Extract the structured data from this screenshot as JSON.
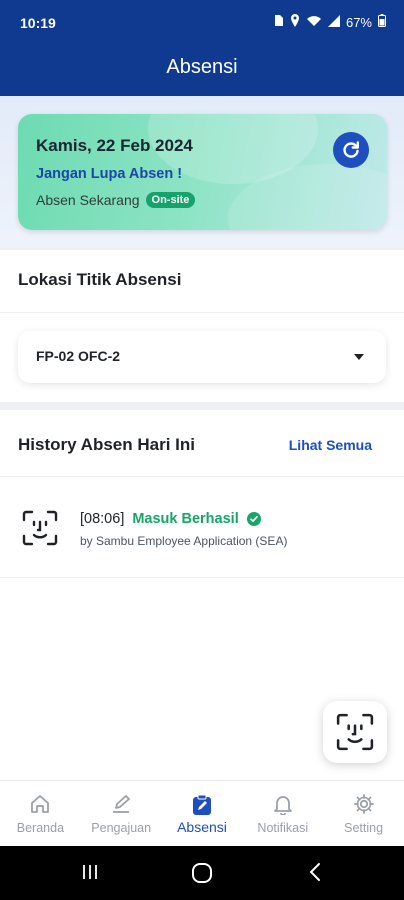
{
  "status_bar": {
    "time": "10:19",
    "battery": "67%"
  },
  "app_bar": {
    "title": "Absensi"
  },
  "date_card": {
    "date": "Kamis, 22 Feb 2024",
    "reminder": "Jangan Lupa Absen !",
    "absen_label": "Absen Sekarang",
    "badge": "On-site"
  },
  "lokasi": {
    "title": "Lokasi Titik Absensi",
    "selected": "FP-02 OFC-2"
  },
  "history": {
    "title": "History Absen Hari Ini",
    "see_all": "Lihat Semua",
    "items": [
      {
        "time": "[08:06]",
        "status": "Masuk Berhasil",
        "source": "by Sambu Employee Application (SEA)"
      }
    ]
  },
  "bottom_nav": {
    "items": [
      {
        "label": "Beranda",
        "icon": "home-icon"
      },
      {
        "label": "Pengajuan",
        "icon": "edit-icon"
      },
      {
        "label": "Absensi",
        "icon": "clipboard-icon",
        "active": true
      },
      {
        "label": "Notifikasi",
        "icon": "bell-icon"
      },
      {
        "label": "Setting",
        "icon": "gear-icon"
      }
    ]
  },
  "colors": {
    "primary": "#0f3a8f",
    "accent": "#1d4fc0",
    "success": "#19a46a"
  }
}
